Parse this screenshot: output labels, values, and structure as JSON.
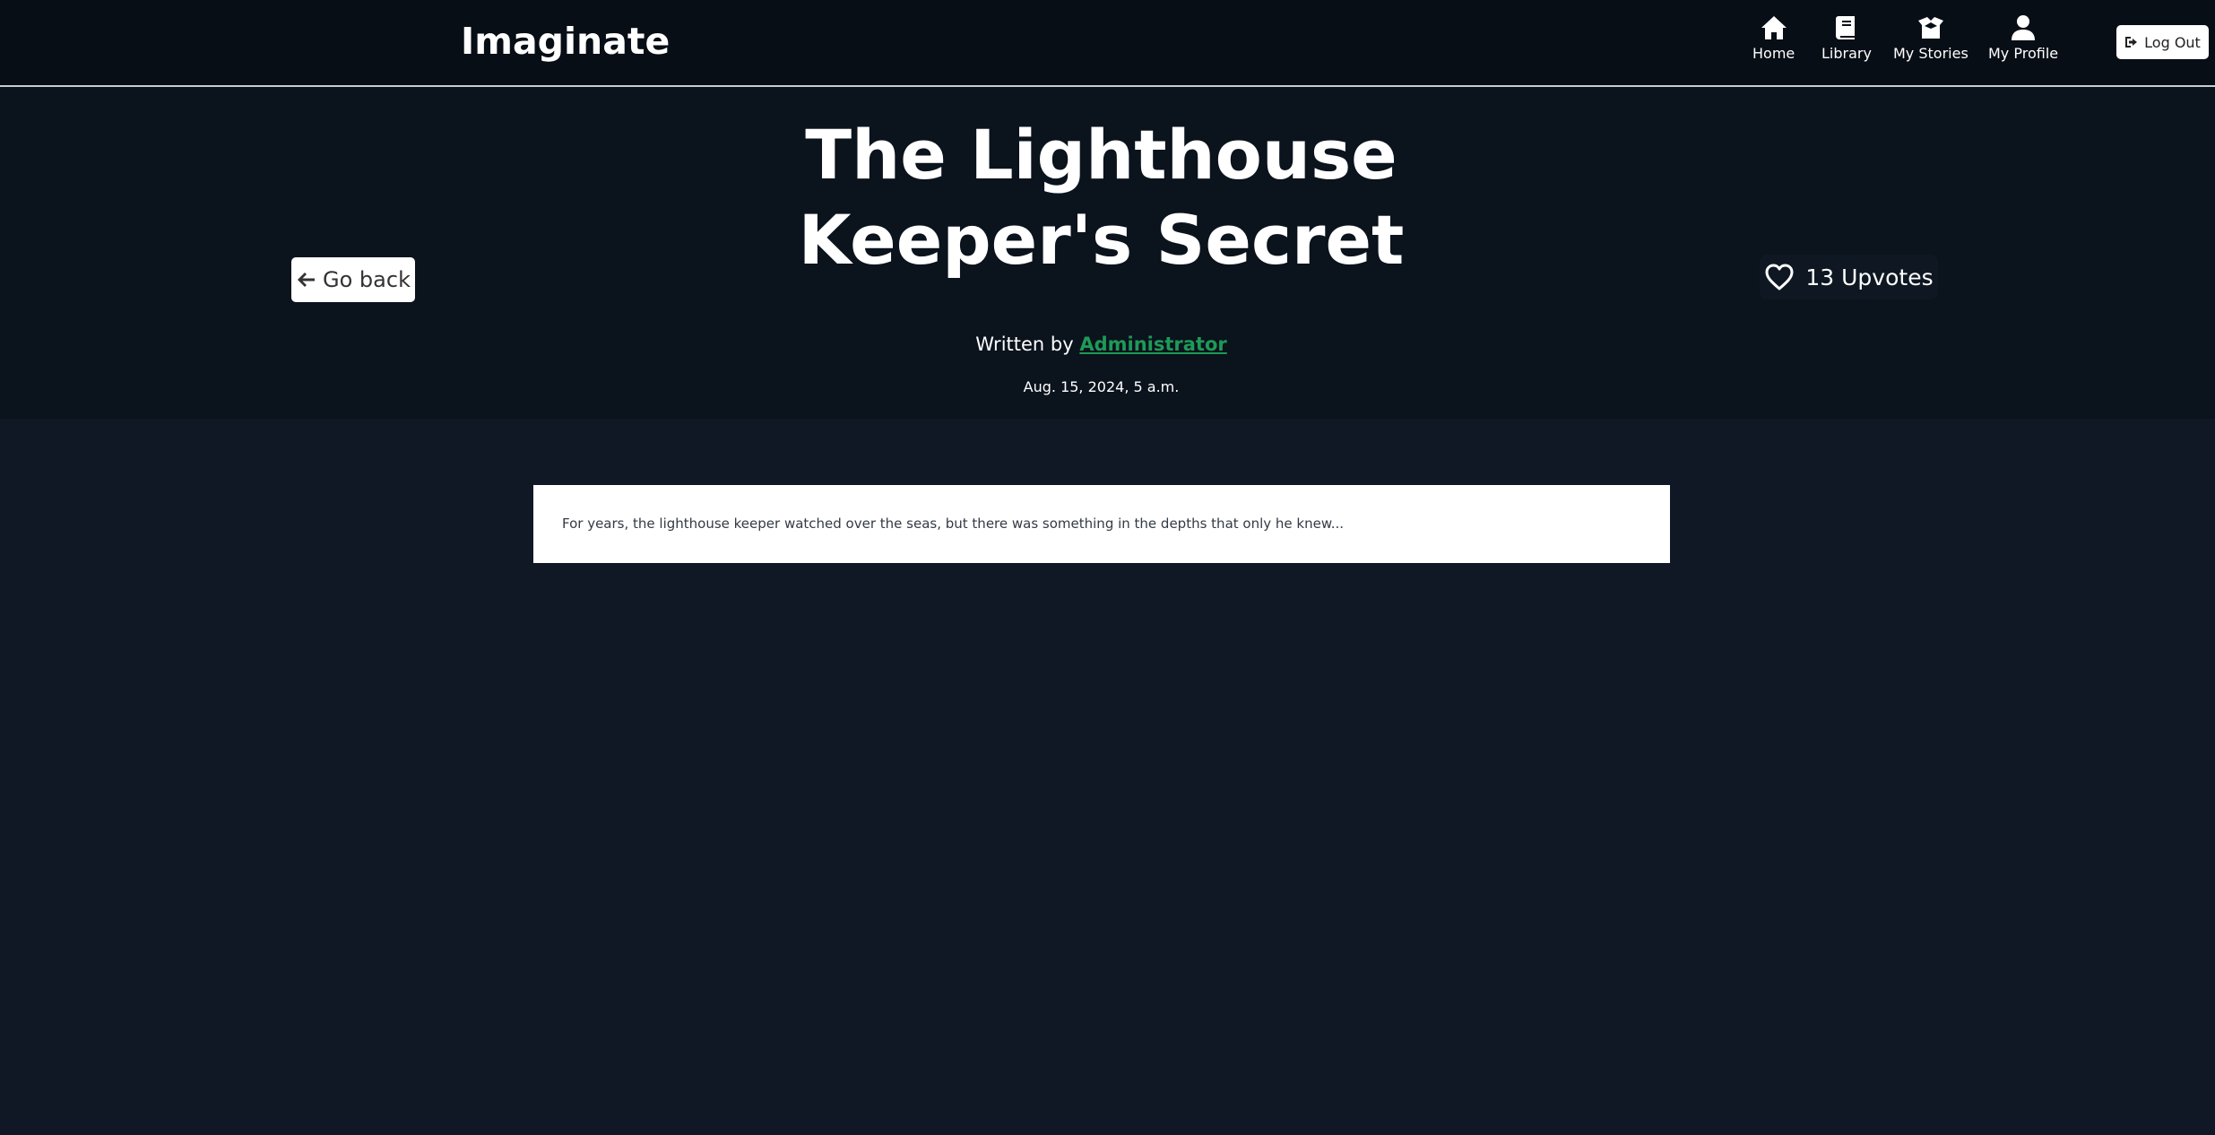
{
  "nav": {
    "brand": "Imaginate",
    "items": [
      {
        "label": "Home",
        "icon": "home-icon"
      },
      {
        "label": "Library",
        "icon": "book-icon"
      },
      {
        "label": "My Stories",
        "icon": "box-open-icon"
      },
      {
        "label": "My Profile",
        "icon": "user-icon"
      }
    ],
    "logout_label": "Log Out"
  },
  "story": {
    "title_line1": "The Lighthouse",
    "title_line2": "Keeper's Secret",
    "go_back_label": "Go back",
    "upvotes_label": "13 Upvotes",
    "written_by": "Written by",
    "author": "Administrator",
    "date": "Aug. 15, 2024, 5 a.m.",
    "body": "For years, the lighthouse keeper watched over the seas, but there was something in the depths that only he knew..."
  },
  "colors": {
    "page_bg": "#0f1824",
    "navbar_bg": "#080e16",
    "hero_bg": "#0b131d",
    "author_link": "#1e9a56"
  }
}
